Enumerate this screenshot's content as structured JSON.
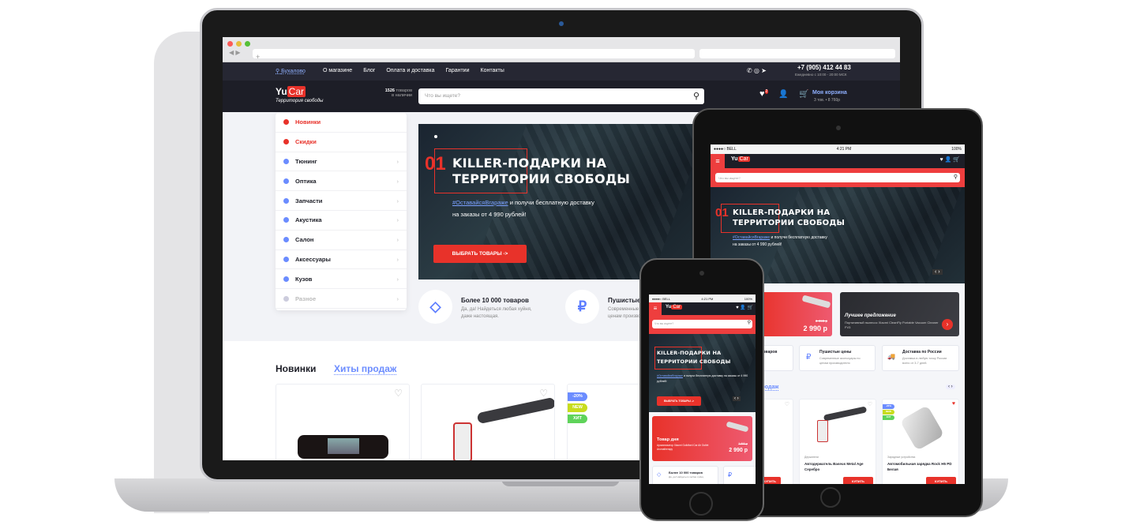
{
  "site": {
    "city": "Бухалово",
    "nav": [
      "О магазине",
      "Блог",
      "Оплата и доставка",
      "Гарантии",
      "Контакты"
    ],
    "phone": "+7 (905) 412 44 83",
    "hours": "Ежедневно с 10:00 - 20:00 МСК",
    "logo_a": "Yu",
    "logo_b": "Car",
    "slogan": "Территория свободы",
    "stock_count": "1526",
    "stock_label1": "товаров",
    "stock_label2": "в наличии",
    "search_placeholder": "Что вы ищете?",
    "wishlist_count": "2",
    "cart_title": "Моя корзина",
    "cart_sub": "3 тов. • 8 760р",
    "menu": [
      {
        "label": "Новинки",
        "color": "#e8322a"
      },
      {
        "label": "Скидки",
        "color": "#e8322a"
      },
      {
        "label": "Тюнинг"
      },
      {
        "label": "Оптика"
      },
      {
        "label": "Запчасти"
      },
      {
        "label": "Акустика"
      },
      {
        "label": "Салон"
      },
      {
        "label": "Аксессуары"
      },
      {
        "label": "Кузов"
      },
      {
        "label": "Разное"
      }
    ],
    "hero": {
      "num": "01",
      "title1": "KILLER-ПОДАРКИ НА",
      "title2": "ТЕРРИТОРИИ СВОБОДЫ",
      "tag": "#ОставайсяВгараже",
      "text1": " и получи бесплатную доставку",
      "text2": "на заказы от 4 990 рублей!",
      "button": "ВЫБРАТЬ ТОВАРЫ ->"
    },
    "features": [
      {
        "title": "Более 10 000 товаров",
        "text1": "Да, да! Найдеться любая хуйня,",
        "text2": "даже настоящая.",
        "icon": "diamond-icon"
      },
      {
        "title": "Пушистые цены",
        "text1": "Современные аксессуары по",
        "text2": "ценам производителя",
        "icon": "ruble-icon"
      },
      {
        "title": "Доставка по России",
        "text1": "Доставка в любую точку России",
        "text2": "всего от 3-7 дней.",
        "icon": "truck-icon"
      }
    ],
    "tabs": [
      "Новинки",
      "Хиты продаж"
    ],
    "badges": [
      "-20%",
      "NEW",
      "ХИТ"
    ],
    "products": [
      {
        "category": "Держатели",
        "name": "Автодержатель Baseus Metal Age Серебро"
      },
      {
        "category": "Зарядные устройства",
        "name": "Автомобильная зарядка Rock H5 PD Белая"
      }
    ],
    "buy": "КУПИТЬ",
    "promo_day": {
      "title": "Товар дня",
      "text": "Ароматизатор Xiaomi Guildford Car Air Outlet Aromatherapy",
      "old": "3 990 р",
      "price": "2 990 р"
    },
    "promo_best": {
      "title": "Лучшее предложение",
      "text": "Портативный пылесос Xiaomi CleanFly Portable Vacuum Cleaner FV3"
    },
    "tablet_section": "Хиты продаж"
  },
  "status": {
    "carrier": "●●●●○ BELL",
    "time": "4:21 PM",
    "battery": "100%"
  },
  "colors": {
    "accent": "#e8322a",
    "link": "#6b8cff",
    "dark": "#1d1e27"
  }
}
